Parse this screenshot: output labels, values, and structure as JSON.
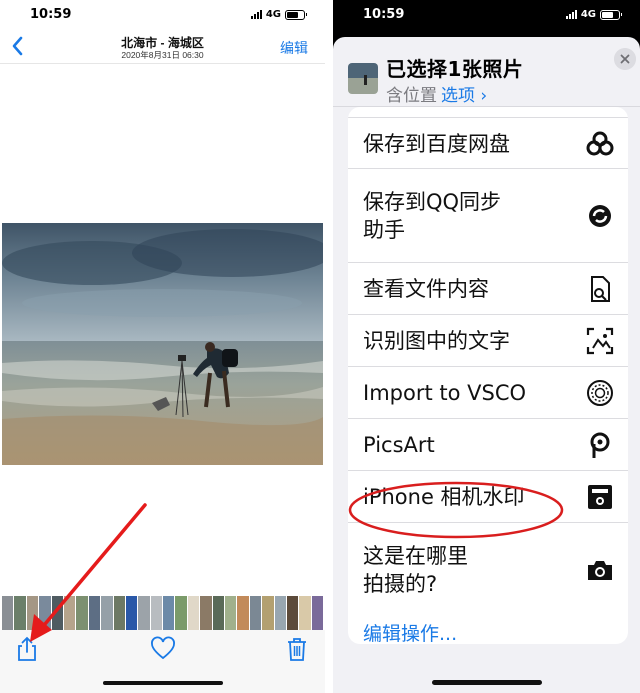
{
  "left": {
    "status": {
      "time": "10:59",
      "network": "4G"
    },
    "nav": {
      "title": "北海市 - 海城区",
      "subtitle": "2020年8月31日  06:30",
      "edit": "编辑"
    },
    "thumbnails": [
      "#8a8f95",
      "#6b7f6a",
      "#a49785",
      "#7a8a9c",
      "#4f5b61",
      "#b5a48c",
      "#7c9070",
      "#5d6e84",
      "#95a0a8",
      "#6d7965",
      "#2a58a8",
      "#9ca3a9",
      "#b8bcc0",
      "#6c8aa8",
      "#7b9b6a",
      "#e0d8c8",
      "#8b7a66",
      "#5a6a58",
      "#a0b08c",
      "#c28a5a",
      "#7b8894",
      "#b3a070",
      "#98a6b0",
      "#5c4a3a",
      "#d9c9a8",
      "#7a6a9a"
    ],
    "arrow_color": "#e51b1b"
  },
  "right": {
    "status": {
      "time": "10:59",
      "network": "4G"
    },
    "sheet": {
      "title": "已选择1张照片",
      "subtitle": "含位置",
      "options": "选项 ›"
    },
    "actions": [
      {
        "label": "保存到百度网盘",
        "icon": "baidu-netdisk-icon"
      },
      {
        "label": "保存到QQ同步\n助手",
        "icon": "qq-sync-icon"
      },
      {
        "label": "查看文件内容",
        "icon": "file-search-icon"
      },
      {
        "label": "识别图中的文字",
        "icon": "text-scan-icon"
      },
      {
        "label": "Import to VSCO",
        "icon": "vsco-icon"
      },
      {
        "label": "PicsArt",
        "icon": "picsart-icon"
      },
      {
        "label": "iPhone 相机水印",
        "icon": "camera-watermark-icon"
      },
      {
        "label": "这是在哪里\n拍摄的?",
        "icon": "camera-icon"
      }
    ],
    "edit_actions": "编辑操作...",
    "accent": "#1a7ae6",
    "highlight_color": "#d91e1e"
  }
}
